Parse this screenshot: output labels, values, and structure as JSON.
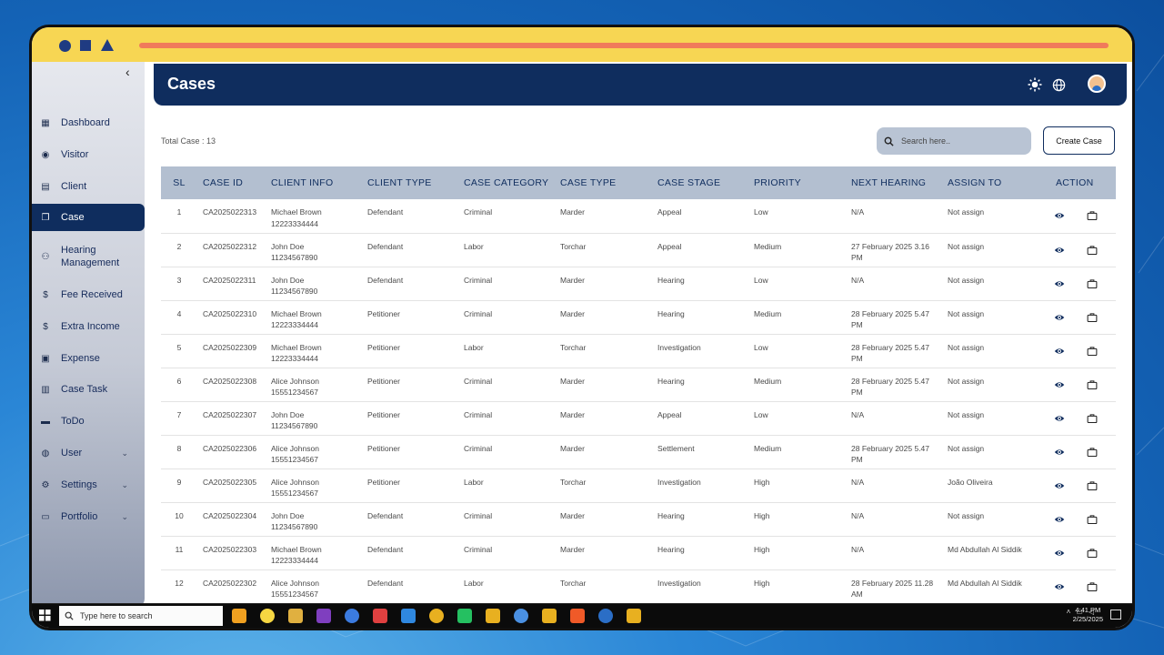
{
  "app": {
    "window_decor": [
      "circle",
      "square",
      "triangle"
    ]
  },
  "sidebar": {
    "collapse_icon": "chevron-left-icon",
    "items": [
      {
        "label": "Dashboard",
        "icon": "dashboard-icon",
        "glyph": "▦"
      },
      {
        "label": "Visitor",
        "icon": "user-circle-icon",
        "glyph": "◉"
      },
      {
        "label": "Client",
        "icon": "client-card-icon",
        "glyph": "▤"
      },
      {
        "label": "Case",
        "icon": "copy-file-icon",
        "glyph": "❐",
        "active": true
      },
      {
        "label": "Hearing Management",
        "icon": "hearing-person-icon",
        "glyph": "⚇"
      },
      {
        "label": "Fee Received",
        "icon": "dollar-circle-icon",
        "glyph": "$"
      },
      {
        "label": "Extra Income",
        "icon": "dollar-circle-icon",
        "glyph": "$"
      },
      {
        "label": "Expense",
        "icon": "receipt-icon",
        "glyph": "▣"
      },
      {
        "label": "Case Task",
        "icon": "task-document-icon",
        "glyph": "▥"
      },
      {
        "label": "ToDo",
        "icon": "folder-icon",
        "glyph": "▬"
      },
      {
        "label": "User",
        "icon": "globe-user-icon",
        "glyph": "◍",
        "expandable": true
      },
      {
        "label": "Settings",
        "icon": "gear-icon",
        "glyph": "⚙",
        "expandable": true
      },
      {
        "label": "Portfolio",
        "icon": "portfolio-icon",
        "glyph": "▭",
        "expandable": true
      }
    ]
  },
  "header": {
    "title": "Cases",
    "icons": [
      "sun-icon",
      "globe-icon",
      "avatar"
    ]
  },
  "toolbar": {
    "total_label": "Total Case : 13",
    "search_placeholder": "Search here..",
    "create_label": "Create Case"
  },
  "table": {
    "columns": [
      "SL",
      "CASE ID",
      "CLIENT INFO",
      "CLIENT TYPE",
      "CASE CATEGORY",
      "CASE TYPE",
      "CASE STAGE",
      "PRIORITY",
      "NEXT HEARING",
      "ASSIGN TO",
      "ACTION"
    ],
    "rows": [
      {
        "sl": "1",
        "case_id": "CA2025022313",
        "client_name": "Michael Brown",
        "client_phone": "12223334444",
        "client_type": "Defendant",
        "category": "Criminal",
        "case_type": "Marder",
        "stage": "Appeal",
        "priority": "Low",
        "next_hearing": "N/A",
        "assign_to": "Not assign"
      },
      {
        "sl": "2",
        "case_id": "CA2025022312",
        "client_name": "John Doe",
        "client_phone": "11234567890",
        "client_type": "Defendant",
        "category": "Labor",
        "case_type": "Torchar",
        "stage": "Appeal",
        "priority": "Medium",
        "next_hearing": "27 February 2025 3.16 PM",
        "assign_to": "Not assign"
      },
      {
        "sl": "3",
        "case_id": "CA2025022311",
        "client_name": "John Doe",
        "client_phone": "11234567890",
        "client_type": "Defendant",
        "category": "Criminal",
        "case_type": "Marder",
        "stage": "Hearing",
        "priority": "Low",
        "next_hearing": "N/A",
        "assign_to": "Not assign"
      },
      {
        "sl": "4",
        "case_id": "CA2025022310",
        "client_name": "Michael Brown",
        "client_phone": "12223334444",
        "client_type": "Petitioner",
        "category": "Criminal",
        "case_type": "Marder",
        "stage": "Hearing",
        "priority": "Medium",
        "next_hearing": "28 February 2025 5.47 PM",
        "assign_to": "Not assign"
      },
      {
        "sl": "5",
        "case_id": "CA2025022309",
        "client_name": "Michael Brown",
        "client_phone": "12223334444",
        "client_type": "Petitioner",
        "category": "Labor",
        "case_type": "Torchar",
        "stage": "Investigation",
        "priority": "Low",
        "next_hearing": "28 February 2025 5.47 PM",
        "assign_to": "Not assign"
      },
      {
        "sl": "6",
        "case_id": "CA2025022308",
        "client_name": "Alice Johnson",
        "client_phone": "15551234567",
        "client_type": "Petitioner",
        "category": "Criminal",
        "case_type": "Marder",
        "stage": "Hearing",
        "priority": "Medium",
        "next_hearing": "28 February 2025 5.47 PM",
        "assign_to": "Not assign"
      },
      {
        "sl": "7",
        "case_id": "CA2025022307",
        "client_name": "John Doe",
        "client_phone": "11234567890",
        "client_type": "Petitioner",
        "category": "Criminal",
        "case_type": "Marder",
        "stage": "Appeal",
        "priority": "Low",
        "next_hearing": "N/A",
        "assign_to": "Not assign"
      },
      {
        "sl": "8",
        "case_id": "CA2025022306",
        "client_name": "Alice Johnson",
        "client_phone": "15551234567",
        "client_type": "Petitioner",
        "category": "Criminal",
        "case_type": "Marder",
        "stage": "Settlement",
        "priority": "Medium",
        "next_hearing": "28 February 2025 5.47 PM",
        "assign_to": "Not assign"
      },
      {
        "sl": "9",
        "case_id": "CA2025022305",
        "client_name": "Alice Johnson",
        "client_phone": "15551234567",
        "client_type": "Petitioner",
        "category": "Labor",
        "case_type": "Torchar",
        "stage": "Investigation",
        "priority": "High",
        "next_hearing": "N/A",
        "assign_to": "João Oliveira"
      },
      {
        "sl": "10",
        "case_id": "CA2025022304",
        "client_name": "John Doe",
        "client_phone": "11234567890",
        "client_type": "Defendant",
        "category": "Criminal",
        "case_type": "Marder",
        "stage": "Hearing",
        "priority": "High",
        "next_hearing": "N/A",
        "assign_to": "Not assign"
      },
      {
        "sl": "11",
        "case_id": "CA2025022303",
        "client_name": "Michael Brown",
        "client_phone": "12223334444",
        "client_type": "Defendant",
        "category": "Criminal",
        "case_type": "Marder",
        "stage": "Hearing",
        "priority": "High",
        "next_hearing": "N/A",
        "assign_to": "Md Abdullah Al Siddik"
      },
      {
        "sl": "12",
        "case_id": "CA2025022302",
        "client_name": "Alice Johnson",
        "client_phone": "15551234567",
        "client_type": "Defendant",
        "category": "Labor",
        "case_type": "Torchar",
        "stage": "Investigation",
        "priority": "High",
        "next_hearing": "28 February 2025 11.28 AM",
        "assign_to": "Md Abdullah Al Siddik"
      }
    ],
    "action_icons": [
      "eye-icon",
      "briefcase-icon"
    ]
  },
  "taskbar": {
    "search_placeholder": "Type here to search",
    "time": "4:41 PM",
    "date": "2/25/2025",
    "apps": [
      "#f0a020",
      "#f6d742",
      "#e0b040",
      "#7f3fbf",
      "#3b7be0",
      "#e04040",
      "#2f88e0",
      "#e8b020",
      "#25c061",
      "#e8b020",
      "#4a90e2",
      "#e8b020",
      "#f05a28",
      "#2b6ec6",
      "#e8b020"
    ]
  },
  "colors": {
    "accent": "#0f2d5e",
    "topbar": "#f7d653",
    "orange": "#f07a5b",
    "table_header": "#b3bfd0"
  }
}
